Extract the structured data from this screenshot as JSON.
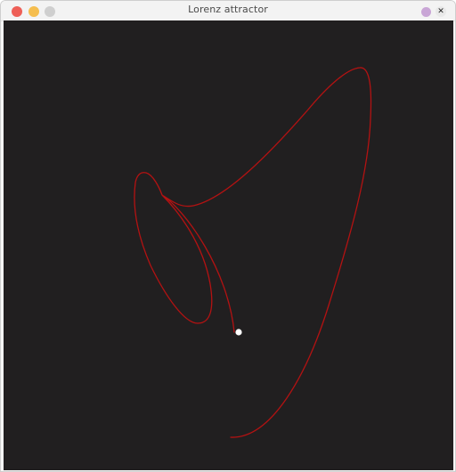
{
  "window": {
    "title": "Lorenz attractor",
    "close_button_color": "#ee5f57",
    "minimize_button_color": "#f5be4f",
    "maximize_button_color": "#cfcfcf",
    "extra_button_color": "#c9a6d6",
    "close_x_label": "✕"
  },
  "canvas": {
    "background_color": "#211f20",
    "trail_color": "#b31212",
    "head_color": "#ffffff"
  },
  "icons": {
    "close": "close-circle-icon",
    "minimize": "minimize-circle-icon",
    "maximize": "maximize-circle-icon",
    "extra": "purple-dot-icon",
    "window_close": "x-icon"
  }
}
